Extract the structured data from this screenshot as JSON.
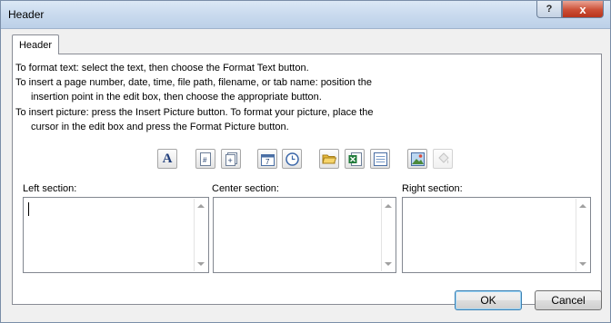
{
  "window": {
    "title": "Header",
    "help_glyph": "?",
    "close_glyph": "x"
  },
  "tab": {
    "label": "Header"
  },
  "instructions": [
    "To format text:  select the text, then choose the Format Text button.",
    "To insert a page number, date, time, file path, filename, or tab name:  position the",
    "insertion point in the edit box, then choose the appropriate button.",
    "To insert picture: press the Insert Picture button.  To format your picture, place the",
    "cursor in the edit box and press the Format Picture button."
  ],
  "toolbar": {
    "format_text_glyph": "A",
    "page_number_glyph": "#",
    "num_pages_glyph": "+",
    "date_glyph": "7"
  },
  "sections": {
    "left_label": "Left section:",
    "center_label": "Center section:",
    "right_label": "Right section:",
    "left_value": "",
    "center_value": "",
    "right_value": ""
  },
  "buttons": {
    "ok": "OK",
    "cancel": "Cancel"
  }
}
